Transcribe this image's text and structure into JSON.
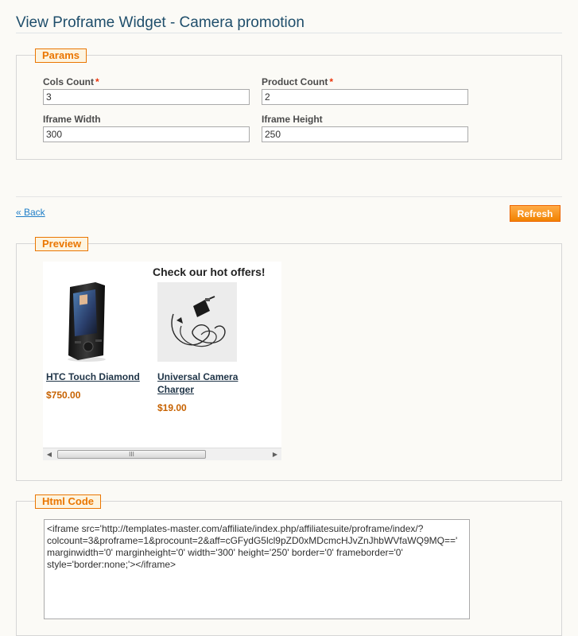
{
  "page": {
    "title": "View Proframe Widget - Camera promotion"
  },
  "params": {
    "legend": "Params",
    "cols_count": {
      "label": "Cols Count",
      "required": "*",
      "value": "3"
    },
    "product_count": {
      "label": "Product Count",
      "required": "*",
      "value": "2"
    },
    "iframe_width": {
      "label": "Iframe Width",
      "value": "300"
    },
    "iframe_height": {
      "label": "Iframe Height",
      "value": "250"
    }
  },
  "actions": {
    "back_label": "« Back",
    "refresh_label": "Refresh"
  },
  "preview": {
    "legend": "Preview",
    "heading": "Check our hot offers!",
    "products": [
      {
        "name_line1": "HTC Touch Diamond",
        "name_line2": "",
        "price": "$750.00"
      },
      {
        "name_line1": "Universal Camera",
        "name_line2": "Charger",
        "price": "$19.00"
      }
    ],
    "scrollbar": {
      "left_arrow": "◀",
      "right_arrow": "▶",
      "grip": "III"
    }
  },
  "html_code": {
    "legend": "Html Code",
    "code": "<iframe src='http://templates-master.com/affiliate/index.php/affiliatesuite/proframe/index/?colcount=3&proframe=1&procount=2&aff=cGFydG5lcl9pZD0xMDcmcHJvZnJhbWVfaWQ9MQ==' marginwidth='0' marginheight='0' width='300' height='250' border='0' frameborder='0' style='border:none;'></iframe>"
  },
  "colors": {
    "accent": "#ea7601",
    "title": "#1f4e6b",
    "link": "#1e7ec8",
    "price": "#c76200"
  }
}
